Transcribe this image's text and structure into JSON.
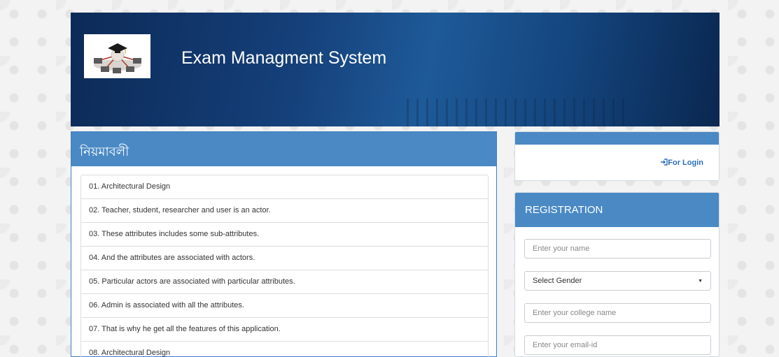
{
  "header": {
    "title": "Exam Managment System",
    "logo_icon": "graduation-network-logo"
  },
  "rules": {
    "heading": "নিয়মাবলী",
    "items": [
      "01. Architectural Design",
      "02. Teacher, student, researcher and user is an actor.",
      "03. These attributes includes some sub-attributes.",
      "04. And the attributes are associated with actors.",
      "05. Particular actors are associated with particular attributes.",
      "06. Admin is associated with all the attributes.",
      "07. That is why he get all the features of this application.",
      "08. Architectural Design"
    ]
  },
  "login": {
    "link_icon": "sign-in-icon",
    "link_label": "For Login"
  },
  "registration": {
    "heading": "REGISTRATION",
    "name_placeholder": "Enter your name",
    "gender_value": "Select Gender",
    "college_placeholder": "Enter your college name",
    "email_placeholder": "Enter your email-id"
  },
  "colors": {
    "panel_header": "#4a89c4",
    "link": "#2a6ebb",
    "header_dark": "#0c2a57"
  }
}
